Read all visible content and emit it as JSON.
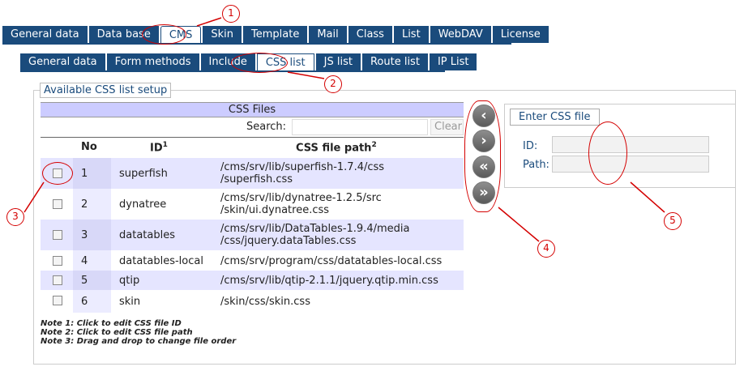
{
  "top_tabs": [
    "General data",
    "Data base",
    "CMS",
    "Skin",
    "Template",
    "Mail",
    "Class",
    "List",
    "WebDAV",
    "License"
  ],
  "sub_tabs": [
    "General data",
    "Form methods",
    "Include",
    "CSS list",
    "JS list",
    "Route list",
    "IP List"
  ],
  "panel_title": "Available CSS list setup",
  "files_header": "CSS Files",
  "search_label": "Search:",
  "clear_label": "Clear",
  "columns": {
    "no": "No",
    "id": "ID",
    "id_sup": "1",
    "path": "CSS file path",
    "path_sup": "2"
  },
  "rows": [
    {
      "no": "1",
      "id": "superfish",
      "path1": "/cms/srv/lib/superfish-1.7.4/css",
      "path2": "/superfish.css"
    },
    {
      "no": "2",
      "id": "dynatree",
      "path1": "/cms/srv/lib/dynatree-1.2.5/src",
      "path2": "/skin/ui.dynatree.css"
    },
    {
      "no": "3",
      "id": "datatables",
      "path1": "/cms/srv/lib/DataTables-1.9.4/media",
      "path2": "/css/jquery.dataTables.css"
    },
    {
      "no": "4",
      "id": "datatables-local",
      "path1": "/cms/srv/program/css/datatables-local.css",
      "path2": ""
    },
    {
      "no": "5",
      "id": "qtip",
      "path1": "/cms/srv/lib/qtip-2.1.1/jquery.qtip.min.css",
      "path2": ""
    },
    {
      "no": "6",
      "id": "skin",
      "path1": "/skin/css/skin.css",
      "path2": ""
    }
  ],
  "notes": [
    "Note 1: Click to edit CSS file ID",
    "Note 2: Click to edit CSS file path",
    "Note 3: Drag and drop to change file order"
  ],
  "right": {
    "enter_label": "Enter CSS file",
    "id_label": "ID:",
    "path_label": "Path:"
  },
  "callouts": [
    "1",
    "2",
    "3",
    "4",
    "5"
  ]
}
